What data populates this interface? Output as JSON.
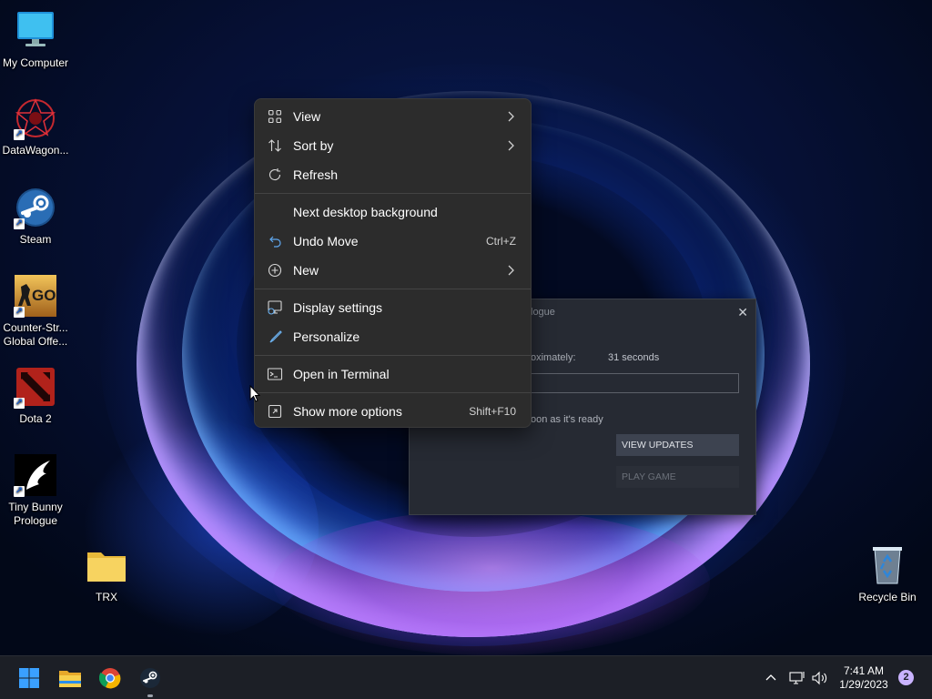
{
  "desktop": {
    "icons": [
      {
        "label": "My Computer",
        "icon": "monitor-icon"
      },
      {
        "label": "DataWagon...",
        "icon": "datawagon-icon"
      },
      {
        "label": "Steam",
        "icon": "steam-icon"
      },
      {
        "label": "Counter-Str... Global Offe...",
        "icon": "csgo-icon",
        "badge": "GO"
      },
      {
        "label": "Dota 2",
        "icon": "dota2-icon"
      },
      {
        "label": "Tiny Bunny Prologue",
        "icon": "tiny-bunny-icon"
      },
      {
        "label": "TRX",
        "icon": "folder-icon"
      },
      {
        "label": "Recycle Bin",
        "icon": "recycle-bin-icon"
      }
    ]
  },
  "context_menu": {
    "items": [
      {
        "label": "View",
        "icon": "view-grid-icon",
        "submenu": true
      },
      {
        "label": "Sort by",
        "icon": "sort-icon",
        "submenu": true
      },
      {
        "label": "Refresh",
        "icon": "refresh-icon"
      },
      {
        "label": "Next desktop background"
      },
      {
        "label": "Undo Move",
        "icon": "undo-icon",
        "shortcut": "Ctrl+Z"
      },
      {
        "label": "New",
        "icon": "new-plus-icon",
        "submenu": true
      },
      {
        "label": "Display settings",
        "icon": "display-settings-icon"
      },
      {
        "label": "Personalize",
        "icon": "personalize-brush-icon"
      },
      {
        "label": "Open in Terminal",
        "icon": "terminal-icon"
      },
      {
        "label": "Show more options",
        "icon": "more-options-icon",
        "shortcut": "Shift+F10"
      }
    ]
  },
  "steam_dialog": {
    "title": "logue",
    "time_label": "oximately:",
    "time_value": "31 seconds",
    "ready_text": "oon as it's ready",
    "view_updates_label": "VIEW UPDATES",
    "play_game_label": "PLAY GAME",
    "close_glyph": "✕"
  },
  "taskbar": {
    "apps": [
      "start-icon",
      "file-explorer-icon",
      "chrome-icon",
      "steam-icon"
    ],
    "tray_icons": [
      "chevron-up-icon",
      "network-icon",
      "volume-icon"
    ],
    "time": "7:41 AM",
    "date": "1/29/2023",
    "notification_count": "2"
  },
  "colors": {
    "menu_bg": "#2c2c2c",
    "taskbar_bg": "#1c1f26",
    "accent": "#1a73e8"
  }
}
